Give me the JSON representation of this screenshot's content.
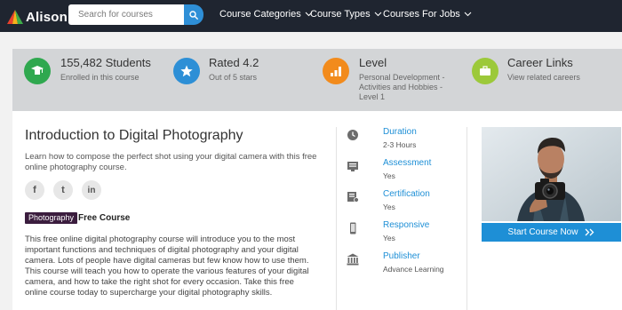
{
  "nav": {
    "logo_text": "Alison",
    "search_placeholder": "Search for courses",
    "menu": [
      {
        "label": "Course Categories"
      },
      {
        "label": "Course Types"
      },
      {
        "label": "Courses For Jobs"
      }
    ]
  },
  "stats": [
    {
      "title": "155,482 Students",
      "subtitle": "Enrolled in this course",
      "icon": "graduate-icon",
      "color": "#2fa84f"
    },
    {
      "title": "Rated 4.2",
      "subtitle": "Out of 5 stars",
      "icon": "star-icon",
      "color": "#2d8fd6"
    },
    {
      "title": "Level",
      "subtitle": "Personal Development - Activities and Hobbies - Level 1",
      "icon": "bar-chart-icon",
      "color": "#f28b1c"
    },
    {
      "title": "Career Links",
      "subtitle": "View related careers",
      "icon": "briefcase-icon",
      "color": "#9cc93a"
    }
  ],
  "course": {
    "title": "Introduction to Digital Photography",
    "description": "Learn how to compose the perfect shot using your digital camera with this free online photography course.",
    "tag": "Photography",
    "type": "Free Course",
    "body": "This free online digital photography course will introduce you to the most important functions and techniques of digital photography and your digital camera. Lots of people have digital cameras but few know how to use them. This course will teach you how to operate the various features of your digital camera, and how to take the right shot for every occasion. Take this free online course today to supercharge your digital photography skills.",
    "social": [
      {
        "glyph": "f",
        "icon": "facebook-icon"
      },
      {
        "glyph": "t",
        "icon": "twitter-icon"
      },
      {
        "glyph": "in",
        "icon": "linkedin-icon"
      }
    ]
  },
  "details": [
    {
      "label": "Duration",
      "value": "2-3 Hours",
      "icon": "clock-icon"
    },
    {
      "label": "Assessment",
      "value": "Yes",
      "icon": "assessment-icon"
    },
    {
      "label": "Certification",
      "value": "Yes",
      "icon": "certificate-icon"
    },
    {
      "label": "Responsive",
      "value": "Yes",
      "icon": "mobile-icon"
    },
    {
      "label": "Publisher",
      "value": "Advance Learning",
      "icon": "institution-icon"
    }
  ],
  "cta": {
    "label": "Start Course Now"
  },
  "colors": {
    "nav": "#1f2530",
    "accent": "#1e8fd6",
    "tag": "#3b1d3e"
  }
}
